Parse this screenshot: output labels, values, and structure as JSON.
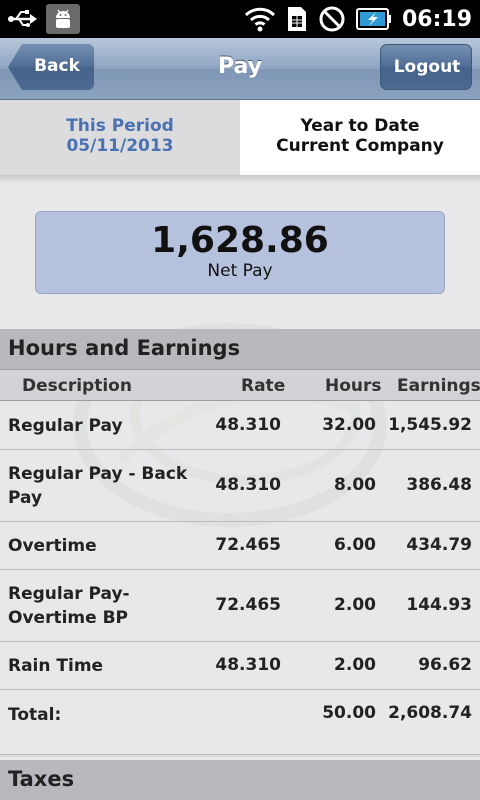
{
  "status_bar": {
    "time": "06:19",
    "icons": [
      "usb-icon",
      "android-debug-icon",
      "wifi-icon",
      "sim-icon",
      "no-signal-icon",
      "battery-charging-icon"
    ]
  },
  "header": {
    "title": "Pay",
    "back_label": "Back",
    "logout_label": "Logout"
  },
  "tabs": [
    {
      "line1": "This Period",
      "line2": "05/11/2013",
      "selected": true
    },
    {
      "line1": "Year to Date",
      "line2": "Current Company",
      "selected": false
    }
  ],
  "net_pay": {
    "amount": "1,628.86",
    "label": "Net Pay"
  },
  "hours_and_earnings": {
    "title": "Hours and Earnings",
    "columns": [
      "Description",
      "Rate",
      "Hours",
      "Earnings"
    ],
    "rows": [
      {
        "description": "Regular Pay",
        "rate": "48.310",
        "hours": "32.00",
        "earnings": "1,545.92"
      },
      {
        "description": "Regular Pay - Back Pay",
        "rate": "48.310",
        "hours": "8.00",
        "earnings": "386.48"
      },
      {
        "description": "Overtime",
        "rate": "72.465",
        "hours": "6.00",
        "earnings": "434.79"
      },
      {
        "description": "Regular Pay-Overtime BP",
        "rate": "72.465",
        "hours": "2.00",
        "earnings": "144.93"
      },
      {
        "description": "Rain Time",
        "rate": "48.310",
        "hours": "2.00",
        "earnings": "96.62"
      }
    ],
    "total": {
      "description": "Total:",
      "rate": "",
      "hours": "50.00",
      "earnings": "2,608.74"
    }
  },
  "taxes": {
    "title": "Taxes"
  },
  "colors": {
    "title_bar": "#8ea5c2",
    "selected_tab_text": "#4a72b2",
    "net_pay_box": "#b6c1dd",
    "section_header": "#b7b9bd"
  }
}
